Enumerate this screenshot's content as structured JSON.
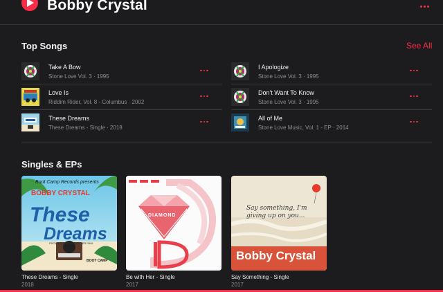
{
  "header": {
    "artist_name": "Bobby Crystal",
    "play_icon": "play-icon",
    "more_icon": "ellipsis-icon"
  },
  "top_songs": {
    "title": "Top Songs",
    "see_all": "See All",
    "left": [
      {
        "name": "Take A Bow",
        "subtitle": "Stone Love Vol. 3 · 1995"
      },
      {
        "name": "Love Is",
        "subtitle": "Riddim Rider, Vol. 8 - Columbus · 2002"
      },
      {
        "name": "These Dreams",
        "subtitle": "These Dreams - Single · 2018"
      }
    ],
    "right": [
      {
        "name": "I Apologize",
        "subtitle": "Stone Love Vol. 3 · 1995"
      },
      {
        "name": "Don't Want To Know",
        "subtitle": "Stone Love Vol. 3 · 1995"
      },
      {
        "name": "All of Me",
        "subtitle": "Stone Love Music, Vol. 1 - EP · 2014"
      }
    ]
  },
  "singles": {
    "title": "Singles & EPs",
    "items": [
      {
        "title": "These Dreams - Single",
        "year": "2018",
        "cover_top": "Boot Camp Records presents",
        "cover_artist": "BOBBY CRYSTAL",
        "cover_line1": "These",
        "cover_line2": "Dreams",
        "cover_credit": "PRODUCED BY COMPUTER PAUL",
        "cover_label": "BOOT CAMP"
      },
      {
        "title": "Be with Her - Single",
        "year": "2017",
        "cover_brand": "DIAMOND"
      },
      {
        "title": "Say Something - Single",
        "year": "2017",
        "cover_script": "Say something, I'm giving up on you...",
        "cover_artist": "Bobby Crystal"
      }
    ]
  },
  "colors": {
    "accent": "#fa2d48",
    "background": "#1c1c1e",
    "secondary_text": "#8e8e93"
  }
}
